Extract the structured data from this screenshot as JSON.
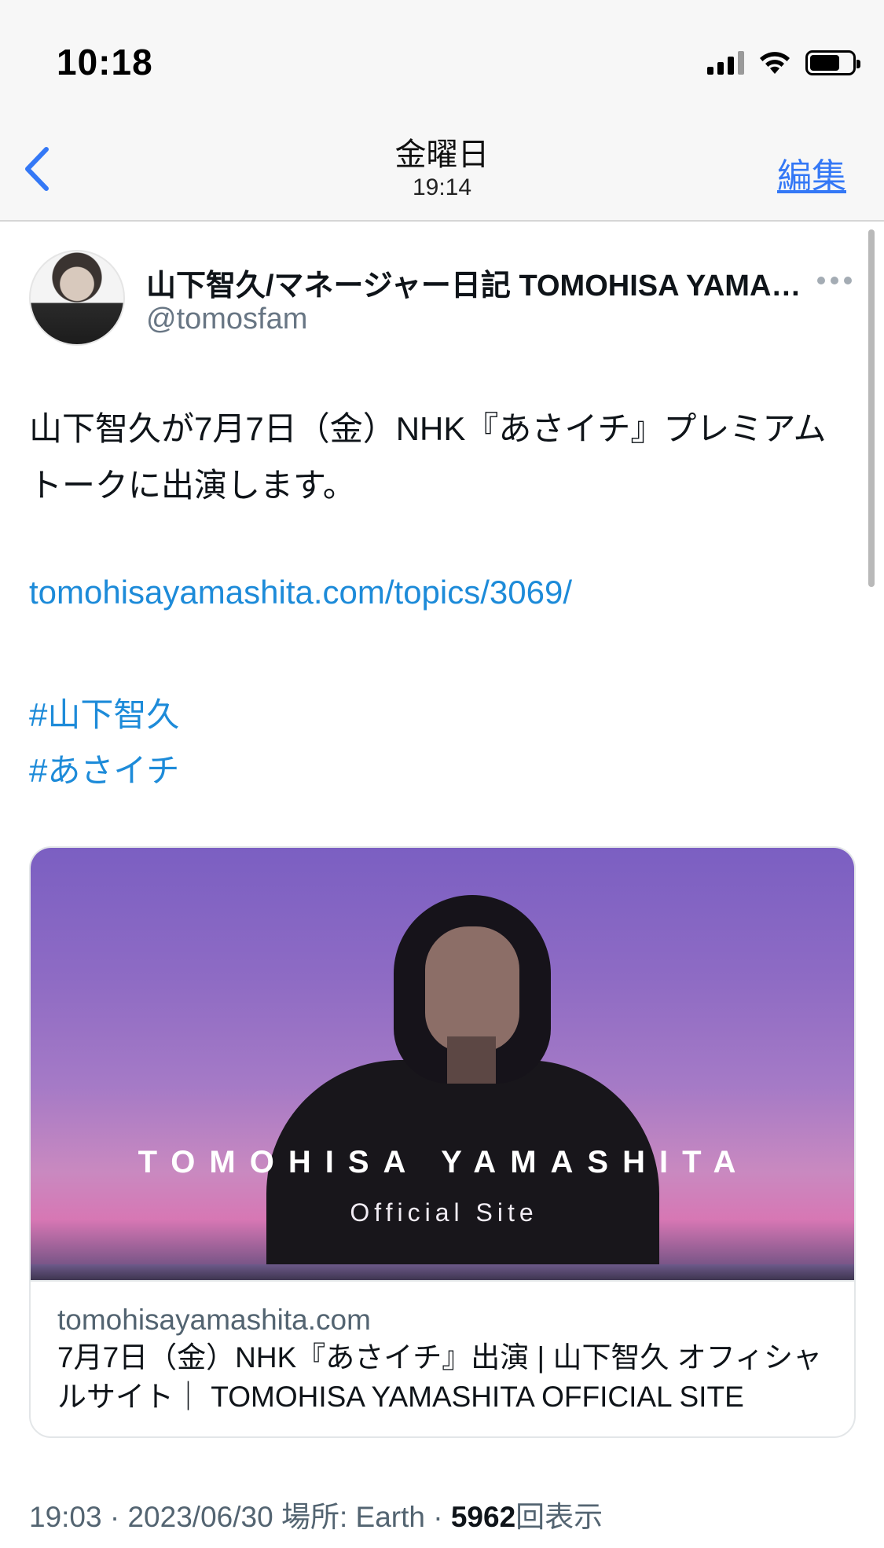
{
  "status_bar": {
    "time": "10:18",
    "battery_level": 0.72
  },
  "nav": {
    "back_icon": "chevron-left-icon",
    "title": "金曜日",
    "subtitle": "19:14",
    "edit_label": "編集",
    "accent_color": "#3478f6"
  },
  "tweet": {
    "display_name": "山下智久/マネージャー日記 TOMOHISA YAMASHITA",
    "handle": "@tomosfam",
    "text": "山下智久が7月7日（金）NHK『あさイチ』プレミアムトークに出演します。",
    "link": "tomohisayamashita.com/topics/3069/",
    "hashtags": [
      "#山下智久",
      "#あさイチ"
    ],
    "link_color": "#1d8bd9"
  },
  "card": {
    "art_title": "TOMOHISA YAMASHITA",
    "art_subtitle": "Official Site",
    "domain": "tomohisayamashita.com",
    "title": "7月7日（金）NHK『あさイチ』出演 | 山下智久 オフィシャルサイト｜ TOMOHISA YAMASHITA OFFICIAL SITE"
  },
  "meta": {
    "time": "19:03",
    "separator": " · ",
    "date": "2023/06/30",
    "location_label": "場所: Earth",
    "view_count": "5962",
    "view_label": "回表示"
  }
}
